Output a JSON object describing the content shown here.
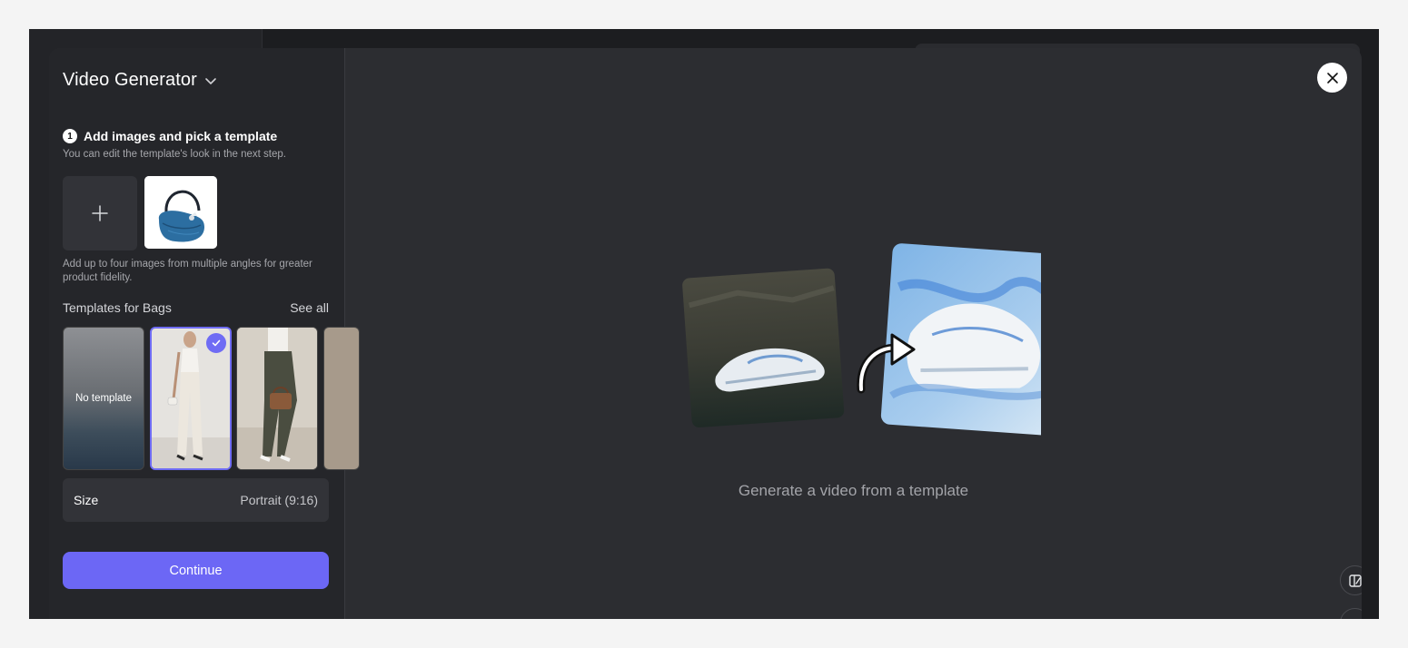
{
  "panel": {
    "title": "Video Generator",
    "step": {
      "number": "1",
      "title": "Add images and pick a template",
      "subtitle": "You can edit the template's look in the next step."
    },
    "upload_hint": "Add up to four images from multiple angles for greater product fidelity.",
    "templates": {
      "heading": "Templates for Bags",
      "see_all": "See all",
      "no_template_label": "No template",
      "selected_index": 1
    },
    "size": {
      "label": "Size",
      "value": "Portrait (9:16)"
    },
    "continue_label": "Continue"
  },
  "main": {
    "caption": "Generate a video from a template"
  },
  "colors": {
    "accent": "#6c67f5",
    "panel_bg": "#25262a",
    "main_bg": "#2c2d31"
  },
  "icons": [
    "chevron-down-icon",
    "plus-icon",
    "check-icon",
    "close-icon",
    "curved-arrow-icon",
    "layout-icon"
  ]
}
